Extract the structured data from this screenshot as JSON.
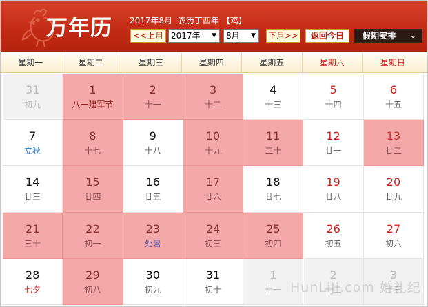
{
  "header": {
    "title": "万年历",
    "date_line": {
      "solar": "2017年8月",
      "lunar": "农历丁酉年",
      "zodiac": "【鸡】"
    },
    "prev_label": "<<上月",
    "year_value": "2017年",
    "month_value": "8月",
    "next_label": "下月>>",
    "today_label": "返回今日",
    "holiday_label": "假期安排"
  },
  "weekdays": [
    "星期一",
    "星期二",
    "星期三",
    "星期四",
    "星期五",
    "星期六",
    "星期日"
  ],
  "days": [
    {
      "d": "31",
      "l": "初九",
      "t": "other"
    },
    {
      "d": "1",
      "l": "八一建军节",
      "t": "hl",
      "f": "fest"
    },
    {
      "d": "2",
      "l": "十一",
      "t": "hl"
    },
    {
      "d": "3",
      "l": "十二",
      "t": "hl"
    },
    {
      "d": "4",
      "l": "十三",
      "t": ""
    },
    {
      "d": "5",
      "l": "十四",
      "t": "wk"
    },
    {
      "d": "6",
      "l": "十五",
      "t": "wk"
    },
    {
      "d": "7",
      "l": "立秋",
      "t": "",
      "f": "term"
    },
    {
      "d": "8",
      "l": "十七",
      "t": "hl"
    },
    {
      "d": "9",
      "l": "十八",
      "t": ""
    },
    {
      "d": "10",
      "l": "十九",
      "t": "hl"
    },
    {
      "d": "11",
      "l": "二十",
      "t": "hl"
    },
    {
      "d": "12",
      "l": "廿一",
      "t": "wk"
    },
    {
      "d": "13",
      "l": "廿二",
      "t": "hl wk"
    },
    {
      "d": "14",
      "l": "廿三",
      "t": ""
    },
    {
      "d": "15",
      "l": "廿四",
      "t": "hl"
    },
    {
      "d": "16",
      "l": "廿五",
      "t": ""
    },
    {
      "d": "17",
      "l": "廿六",
      "t": "hl"
    },
    {
      "d": "18",
      "l": "廿七",
      "t": ""
    },
    {
      "d": "19",
      "l": "廿八",
      "t": "wk"
    },
    {
      "d": "20",
      "l": "廿九",
      "t": "wk"
    },
    {
      "d": "21",
      "l": "三十",
      "t": "hl"
    },
    {
      "d": "22",
      "l": "初一",
      "t": "hl"
    },
    {
      "d": "23",
      "l": "处暑",
      "t": "hl",
      "f": "term"
    },
    {
      "d": "24",
      "l": "初三",
      "t": "hl"
    },
    {
      "d": "25",
      "l": "初四",
      "t": "hl"
    },
    {
      "d": "26",
      "l": "初五",
      "t": "wk"
    },
    {
      "d": "27",
      "l": "初六",
      "t": "wk"
    },
    {
      "d": "28",
      "l": "七夕",
      "t": "",
      "f": "qixi"
    },
    {
      "d": "29",
      "l": "初八",
      "t": "hl"
    },
    {
      "d": "30",
      "l": "初九",
      "t": ""
    },
    {
      "d": "31",
      "l": "初十",
      "t": ""
    },
    {
      "d": "1",
      "l": "十一",
      "t": "other"
    },
    {
      "d": "2",
      "l": "十二",
      "t": "other"
    },
    {
      "d": "3",
      "l": "十三",
      "t": "other"
    }
  ],
  "watermark": "HunLiJi.com 婚礼纪",
  "colors": {
    "header_red": "#c12a14",
    "highlight_pink": "#f4a9a8",
    "weekend_red": "#d21e1e"
  }
}
